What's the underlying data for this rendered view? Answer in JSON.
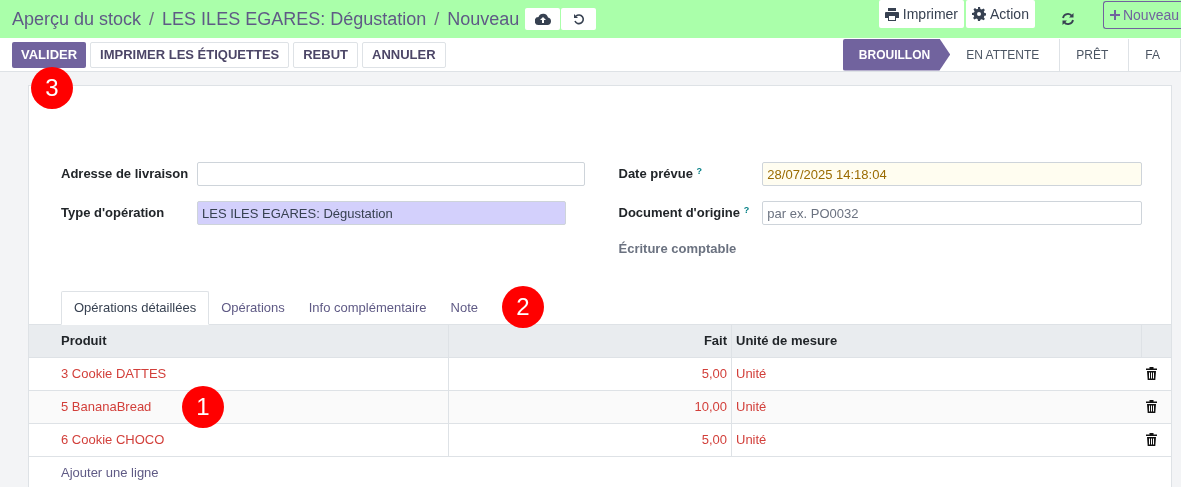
{
  "breadcrumb": [
    {
      "label": "Aperçu du stock"
    },
    {
      "separator": "/",
      "label": "LES ILES EGARES: Dégustation"
    },
    {
      "separator": "/",
      "label": "Nouveau"
    }
  ],
  "top_actions": [
    {
      "label": "Imprimer",
      "kind": "print"
    },
    {
      "label": "Action",
      "kind": "gear"
    }
  ],
  "new_button": {
    "label": "Nouveau"
  },
  "action_buttons": [
    {
      "label": "VALIDER",
      "primary": true
    },
    {
      "label": "IMPRIMER LES ÉTIQUETTES",
      "primary": false
    },
    {
      "label": "REBUT",
      "primary": false
    },
    {
      "label": "ANNULER",
      "primary": false
    }
  ],
  "status_bar": [
    {
      "label": "BROUILLON",
      "selected": true
    },
    {
      "label": "EN ATTENTE",
      "selected": false
    },
    {
      "label": "PRÊT",
      "selected": false
    },
    {
      "label": "FA",
      "selected": false
    }
  ],
  "form_left": [
    {
      "label": "Adresse de livraison",
      "highlighted": false
    },
    {
      "label": "Type d'opération",
      "value": "LES ILES EGARES: Dégustation",
      "highlighted": true
    }
  ],
  "form_right": [
    {
      "label": "Date prévue",
      "help": "?",
      "value": "28/07/2025 14:18:04"
    },
    {
      "label": "Document d'origine",
      "help": "?",
      "placeholder": "par ex. PO0032"
    }
  ],
  "accounting_label": "Écriture comptable",
  "tabs": [
    {
      "label": "Opérations détaillées",
      "selected": true
    },
    {
      "label": "Opérations",
      "selected": false
    },
    {
      "label": "Info complémentaire",
      "selected": false
    },
    {
      "label": "Note",
      "selected": false
    }
  ],
  "table": {
    "columns": [
      "Produit",
      "Fait",
      "Unité de mesure"
    ],
    "rows": [
      {
        "product": "3 Cookie DATTES",
        "done": "5,00",
        "uom": "Unité"
      },
      {
        "product": "5 BananaBread",
        "done": "10,00",
        "uom": "Unité"
      },
      {
        "product": "6 Cookie CHOCO",
        "done": "5,00",
        "uom": "Unité"
      }
    ],
    "add_line": "Ajouter une ligne"
  },
  "markers": [
    "1",
    "2",
    "3"
  ]
}
